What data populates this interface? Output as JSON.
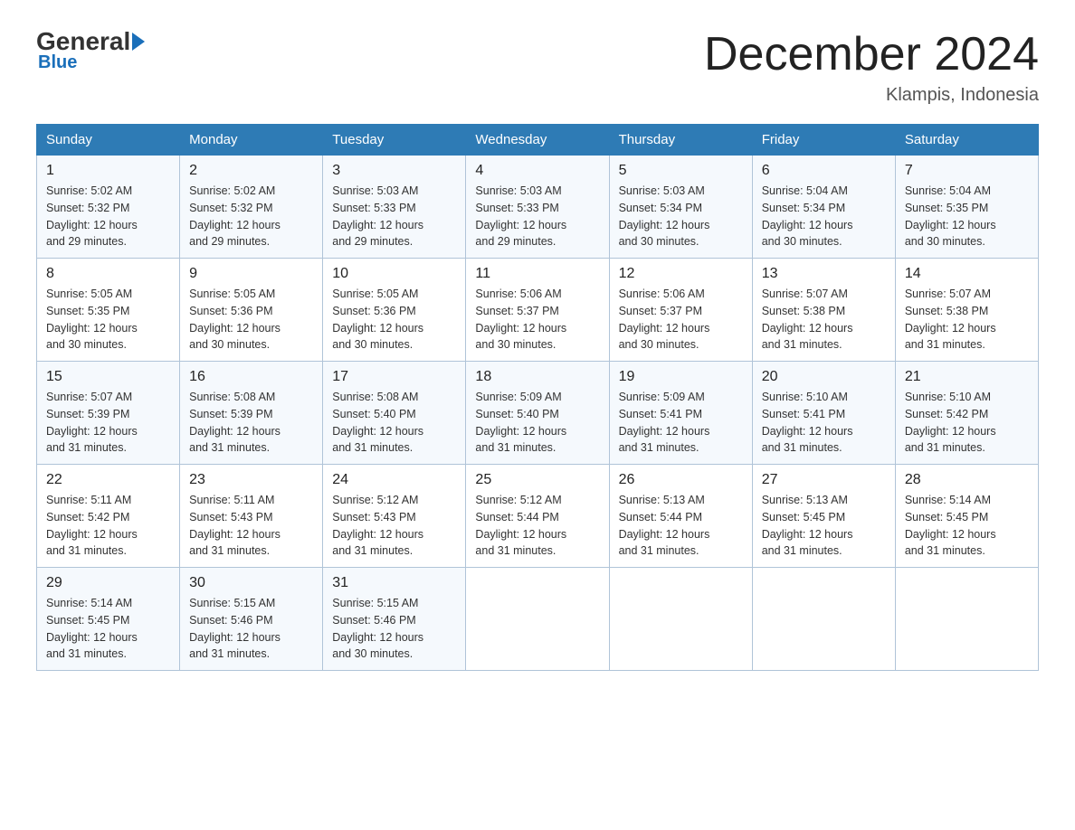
{
  "header": {
    "logo_general": "General",
    "logo_blue": "Blue",
    "month_title": "December 2024",
    "location": "Klampis, Indonesia"
  },
  "days_of_week": [
    "Sunday",
    "Monday",
    "Tuesday",
    "Wednesday",
    "Thursday",
    "Friday",
    "Saturday"
  ],
  "weeks": [
    [
      {
        "day": "1",
        "sunrise": "5:02 AM",
        "sunset": "5:32 PM",
        "daylight": "12 hours and 29 minutes."
      },
      {
        "day": "2",
        "sunrise": "5:02 AM",
        "sunset": "5:32 PM",
        "daylight": "12 hours and 29 minutes."
      },
      {
        "day": "3",
        "sunrise": "5:03 AM",
        "sunset": "5:33 PM",
        "daylight": "12 hours and 29 minutes."
      },
      {
        "day": "4",
        "sunrise": "5:03 AM",
        "sunset": "5:33 PM",
        "daylight": "12 hours and 29 minutes."
      },
      {
        "day": "5",
        "sunrise": "5:03 AM",
        "sunset": "5:34 PM",
        "daylight": "12 hours and 30 minutes."
      },
      {
        "day": "6",
        "sunrise": "5:04 AM",
        "sunset": "5:34 PM",
        "daylight": "12 hours and 30 minutes."
      },
      {
        "day": "7",
        "sunrise": "5:04 AM",
        "sunset": "5:35 PM",
        "daylight": "12 hours and 30 minutes."
      }
    ],
    [
      {
        "day": "8",
        "sunrise": "5:05 AM",
        "sunset": "5:35 PM",
        "daylight": "12 hours and 30 minutes."
      },
      {
        "day": "9",
        "sunrise": "5:05 AM",
        "sunset": "5:36 PM",
        "daylight": "12 hours and 30 minutes."
      },
      {
        "day": "10",
        "sunrise": "5:05 AM",
        "sunset": "5:36 PM",
        "daylight": "12 hours and 30 minutes."
      },
      {
        "day": "11",
        "sunrise": "5:06 AM",
        "sunset": "5:37 PM",
        "daylight": "12 hours and 30 minutes."
      },
      {
        "day": "12",
        "sunrise": "5:06 AM",
        "sunset": "5:37 PM",
        "daylight": "12 hours and 30 minutes."
      },
      {
        "day": "13",
        "sunrise": "5:07 AM",
        "sunset": "5:38 PM",
        "daylight": "12 hours and 31 minutes."
      },
      {
        "day": "14",
        "sunrise": "5:07 AM",
        "sunset": "5:38 PM",
        "daylight": "12 hours and 31 minutes."
      }
    ],
    [
      {
        "day": "15",
        "sunrise": "5:07 AM",
        "sunset": "5:39 PM",
        "daylight": "12 hours and 31 minutes."
      },
      {
        "day": "16",
        "sunrise": "5:08 AM",
        "sunset": "5:39 PM",
        "daylight": "12 hours and 31 minutes."
      },
      {
        "day": "17",
        "sunrise": "5:08 AM",
        "sunset": "5:40 PM",
        "daylight": "12 hours and 31 minutes."
      },
      {
        "day": "18",
        "sunrise": "5:09 AM",
        "sunset": "5:40 PM",
        "daylight": "12 hours and 31 minutes."
      },
      {
        "day": "19",
        "sunrise": "5:09 AM",
        "sunset": "5:41 PM",
        "daylight": "12 hours and 31 minutes."
      },
      {
        "day": "20",
        "sunrise": "5:10 AM",
        "sunset": "5:41 PM",
        "daylight": "12 hours and 31 minutes."
      },
      {
        "day": "21",
        "sunrise": "5:10 AM",
        "sunset": "5:42 PM",
        "daylight": "12 hours and 31 minutes."
      }
    ],
    [
      {
        "day": "22",
        "sunrise": "5:11 AM",
        "sunset": "5:42 PM",
        "daylight": "12 hours and 31 minutes."
      },
      {
        "day": "23",
        "sunrise": "5:11 AM",
        "sunset": "5:43 PM",
        "daylight": "12 hours and 31 minutes."
      },
      {
        "day": "24",
        "sunrise": "5:12 AM",
        "sunset": "5:43 PM",
        "daylight": "12 hours and 31 minutes."
      },
      {
        "day": "25",
        "sunrise": "5:12 AM",
        "sunset": "5:44 PM",
        "daylight": "12 hours and 31 minutes."
      },
      {
        "day": "26",
        "sunrise": "5:13 AM",
        "sunset": "5:44 PM",
        "daylight": "12 hours and 31 minutes."
      },
      {
        "day": "27",
        "sunrise": "5:13 AM",
        "sunset": "5:45 PM",
        "daylight": "12 hours and 31 minutes."
      },
      {
        "day": "28",
        "sunrise": "5:14 AM",
        "sunset": "5:45 PM",
        "daylight": "12 hours and 31 minutes."
      }
    ],
    [
      {
        "day": "29",
        "sunrise": "5:14 AM",
        "sunset": "5:45 PM",
        "daylight": "12 hours and 31 minutes."
      },
      {
        "day": "30",
        "sunrise": "5:15 AM",
        "sunset": "5:46 PM",
        "daylight": "12 hours and 31 minutes."
      },
      {
        "day": "31",
        "sunrise": "5:15 AM",
        "sunset": "5:46 PM",
        "daylight": "12 hours and 30 minutes."
      },
      null,
      null,
      null,
      null
    ]
  ]
}
